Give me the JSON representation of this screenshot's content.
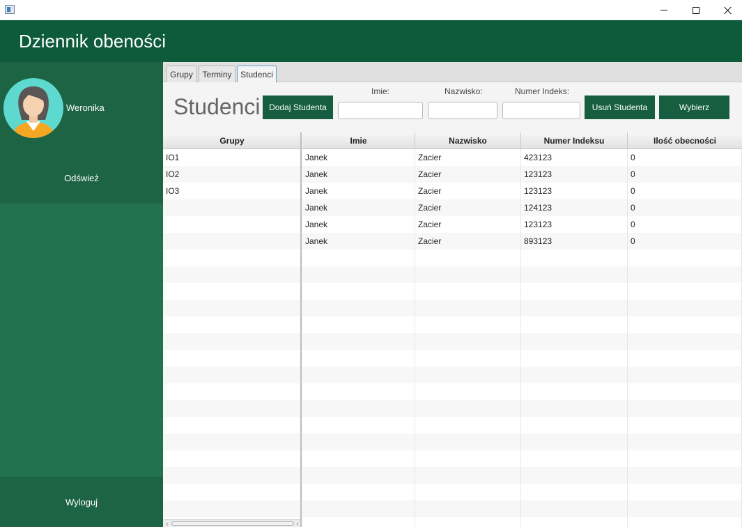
{
  "header": {
    "title": "Dziennik obeności"
  },
  "sidebar": {
    "user_name": "Weronika",
    "refresh_label": "Odśwież",
    "logout_label": "Wyloguj"
  },
  "tabs": [
    {
      "label": "Grupy"
    },
    {
      "label": "Terminy"
    },
    {
      "label": "Studenci"
    }
  ],
  "toolbar": {
    "title": "Studenci",
    "add_label": "Dodaj Studenta",
    "remove_label": "Usuń Studenta",
    "select_label": "Wybierz",
    "fields": {
      "first_name": {
        "label": "Imie:",
        "value": ""
      },
      "last_name": {
        "label": "Nazwisko:",
        "value": ""
      },
      "index": {
        "label": "Numer Indeks:",
        "value": ""
      }
    }
  },
  "groups_table": {
    "header": "Grupy",
    "rows": [
      "IO1",
      "IO2",
      "IO3"
    ]
  },
  "students_table": {
    "headers": [
      "Imie",
      "Nazwisko",
      "Numer Indeksu",
      "Ilość obecności"
    ],
    "rows": [
      [
        "Janek",
        "Zacier",
        "423123",
        "0"
      ],
      [
        "Janek",
        "Zacier",
        "123123",
        "0"
      ],
      [
        "Janek",
        "Zacier",
        "123123",
        "0"
      ],
      [
        "Janek",
        "Zacier",
        "124123",
        "0"
      ],
      [
        "Janek",
        "Zacier",
        "123123",
        "0"
      ],
      [
        "Janek",
        "Zacier",
        "893123",
        "0"
      ]
    ]
  },
  "colors": {
    "header_bg": "#0d5b3a",
    "sidebar_bg": "#22724f",
    "sidebar_block_bg": "#1d6444",
    "button_bg": "#165e3f",
    "avatar_bg": "#5dd9d0",
    "active_tab_border": "#5ba2d6"
  },
  "icons": {
    "app": "app-window-icon",
    "minimize": "minimize-icon",
    "maximize": "maximize-icon",
    "close": "close-icon",
    "avatar": "woman-avatar-icon",
    "scroll_left": "scroll-left-arrow-icon",
    "scroll_right": "scroll-right-arrow-icon"
  }
}
